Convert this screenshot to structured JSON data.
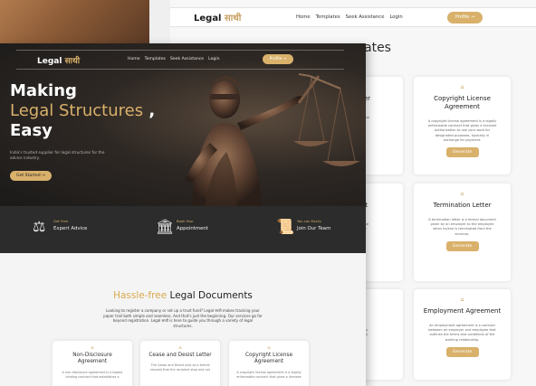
{
  "brand": {
    "name_en": "Legal",
    "name_hi": "साथी",
    "accent": "#d9b16b",
    "dark": "#2b2c2b"
  },
  "nav": {
    "links": [
      "Home",
      "Templates",
      "Seek Assistance",
      "Login"
    ],
    "profile": "Profile"
  },
  "back": {
    "heading": "ates",
    "cards": [
      {
        "icon": "document-icon",
        "title": "sist Letter",
        "desc": "s as a formal\nve to stop and not\nt have\nntract.",
        "button": ""
      },
      {
        "icon": "document-icon",
        "title": "Copyright License Agreement",
        "desc": "A copyright license agreement is a legally\nenforceable contract that gives a licensee\nauthorization to use your work for\ndesignated purposes, typically in\nexchange for payment.",
        "button": "Generate"
      },
      {
        "icon": "document-icon",
        "title": "ignment",
        "desc": "eement is an\nthe copyright the\nright owned to\nvey.",
        "button": ""
      },
      {
        "icon": "document-icon",
        "title": "Termination Letter",
        "desc": "A termination letter is a formal document\ngiven by an employer to the employee\nwhen he/she is terminated from the\nservices.",
        "button": "Generate"
      },
      {
        "icon": "document-icon",
        "title": "olicy",
        "desc": "nent that\nyou handles any\nmer information\nerations.",
        "button": ""
      },
      {
        "icon": "document-icon",
        "title": "Employment Agreement",
        "desc": "An employment agreement is a contract\nbetween an employer and employee that\noutlines the terms and conditions of the\nworking relationship.",
        "button": "Generate"
      }
    ]
  },
  "hero": {
    "line1": "Making",
    "line2": "Legal Structures",
    "line2_suffix": " ,",
    "line3": "Easy",
    "subtitle": "India's trusted supplier for legal structures for the advice industry.",
    "cta": "Get Started →"
  },
  "features": [
    {
      "icon": "lawyer-icon",
      "small": "Get Free",
      "big": "Expert Advice"
    },
    {
      "icon": "courthouse-icon",
      "small": "Book Your",
      "big": "Appointment"
    },
    {
      "icon": "document-scroll-icon",
      "small": "You can Easily",
      "big": "Join Our Team"
    }
  ],
  "section": {
    "title_gold": "Hassle-free",
    "title_dark": " Legal Documents",
    "intro": "Looking to register a company or set up a trust fund? Legal साथी makes tracking your paper trail both simple and seamless. And that's just the beginning. Our services go far beyond registration. Legal साथी is here to guide you through a variety of legal structures."
  },
  "front_cards": [
    {
      "icon": "document-icon",
      "title": "Non-Disclosure Agreement",
      "desc": "A non-disclosure agreement is a legally\nbinding contract that establishes a"
    },
    {
      "icon": "document-icon",
      "title": "Cease and Desist Letter",
      "desc": "The Cease and Desist acts as a formal\nrequest that the recipient stop and not"
    },
    {
      "icon": "document-icon",
      "title": "Copyright License Agreement",
      "desc": "A copyright license agreement is a legally\nenforceable contract that gives a licensee"
    }
  ]
}
